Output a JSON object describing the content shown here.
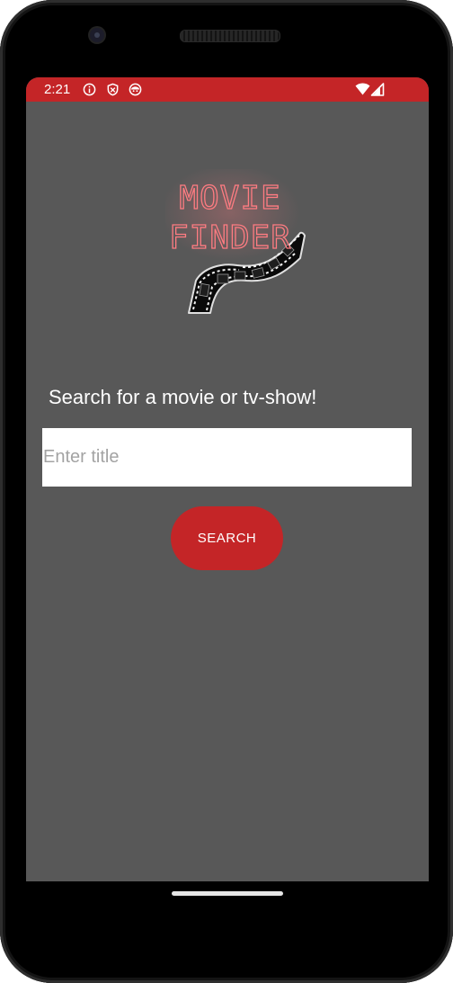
{
  "status_bar": {
    "time": "2:21",
    "left_icons": [
      "info-icon",
      "shield-icon",
      "face-icon"
    ],
    "right_icons": [
      "wifi-icon",
      "cell-signal-icon"
    ]
  },
  "logo": {
    "line1": "MOVIE",
    "line2": "FINDER"
  },
  "prompt": "Search for a movie or tv-show!",
  "search": {
    "placeholder": "Enter title",
    "value": "",
    "button_label": "SEARCH"
  },
  "colors": {
    "accent": "#c42527",
    "background": "#585858",
    "neon_text": "#ff7c82"
  }
}
